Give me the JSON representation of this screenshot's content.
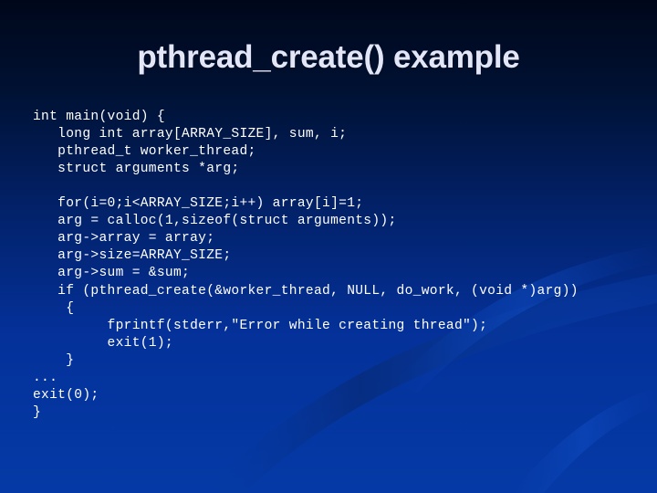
{
  "slide": {
    "title": "pthread_create() example",
    "title_color": "#e3e6f7",
    "background_top_color": "#00071a",
    "background_bottom_color": "#053aa6",
    "code_color": "#ffffff"
  },
  "code": {
    "language": "c",
    "lines": [
      "int main(void) {",
      "   long int array[ARRAY_SIZE], sum, i;",
      "   pthread_t worker_thread;",
      "   struct arguments *arg;",
      "",
      "   for(i=0;i<ARRAY_SIZE;i++) array[i]=1;",
      "   arg = calloc(1,sizeof(struct arguments));",
      "   arg->array = array;",
      "   arg->size=ARRAY_SIZE;",
      "   arg->sum = &sum;",
      "   if (pthread_create(&worker_thread, NULL, do_work, (void *)arg))",
      "    {",
      "         fprintf(stderr,\"Error while creating thread\");",
      "         exit(1);",
      "    }",
      "...",
      "exit(0);",
      "}"
    ]
  }
}
